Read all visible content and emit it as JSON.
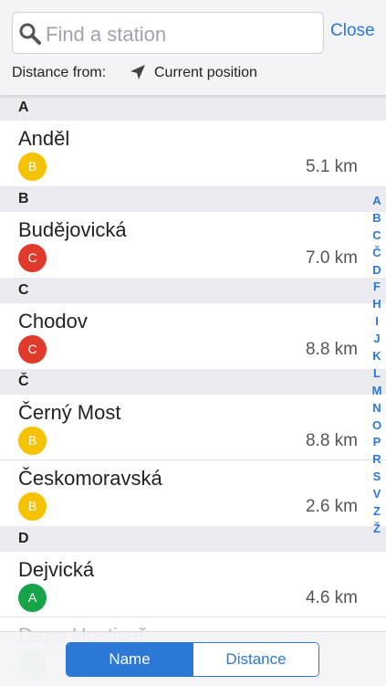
{
  "search": {
    "placeholder": "Find a station",
    "value": "",
    "close_label": "Close"
  },
  "distance": {
    "label": "Distance from:",
    "source": "Current position"
  },
  "colors": {
    "line_A": "#16a34a",
    "line_B": "#f5c200",
    "line_C": "#e03a2b",
    "accent": "#2b78d6"
  },
  "sections": [
    {
      "letter": "A",
      "stations": [
        {
          "name": "Anděl",
          "line": "B",
          "distance": "5.1 km"
        }
      ]
    },
    {
      "letter": "B",
      "stations": [
        {
          "name": "Budějovická",
          "line": "C",
          "distance": "7.0 km"
        }
      ]
    },
    {
      "letter": "C",
      "stations": [
        {
          "name": "Chodov",
          "line": "C",
          "distance": "8.8 km"
        }
      ]
    },
    {
      "letter": "Č",
      "stations": [
        {
          "name": "Černý Most",
          "line": "B",
          "distance": "8.8 km"
        },
        {
          "name": "Českomoravská",
          "line": "B",
          "distance": "2.6 km"
        }
      ]
    },
    {
      "letter": "D",
      "stations": [
        {
          "name": "Dejvická",
          "line": "A",
          "distance": "4.6 km"
        },
        {
          "name": "Depo Hostivař",
          "line": "A",
          "distance": ""
        }
      ]
    }
  ],
  "alphabet": [
    "A",
    "B",
    "C",
    "Č",
    "D",
    "F",
    "H",
    "I",
    "J",
    "K",
    "L",
    "M",
    "N",
    "O",
    "P",
    "R",
    "S",
    "V",
    "Z",
    "Ž"
  ],
  "sort": {
    "options": [
      "Name",
      "Distance"
    ],
    "selected": "Name"
  }
}
